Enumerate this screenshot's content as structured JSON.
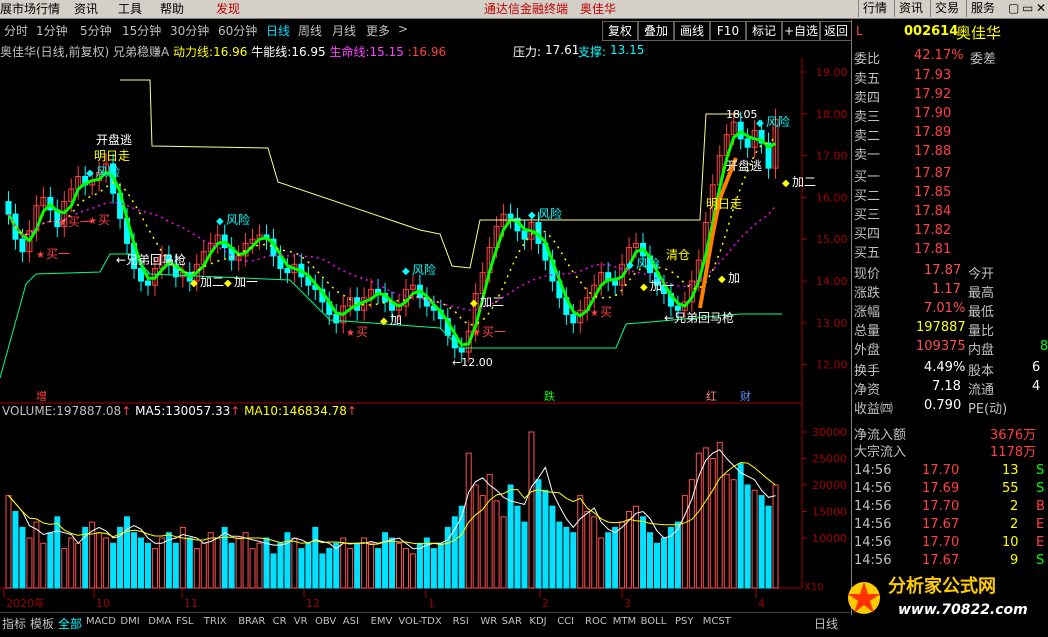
{
  "menu": {
    "items": [
      "展市场行情",
      "资讯",
      "工具",
      "帮助",
      "发现"
    ],
    "center": [
      "通达信金融终端",
      "奥佳华"
    ],
    "right": [
      "行情",
      "资讯",
      "交易",
      "服务"
    ],
    "win": [
      "▢",
      "▭",
      "✕"
    ]
  },
  "toolbar": {
    "periods": [
      "分时",
      "1分钟",
      "5分钟",
      "15分钟",
      "30分钟",
      "60分钟",
      "日线",
      "周线",
      "月线",
      "更多"
    ],
    "more_arrow": ">",
    "buttons": [
      "复权",
      "叠加",
      "画线",
      "F10",
      "标记",
      "+自选",
      "返回"
    ]
  },
  "info": {
    "name": "奥佳华(日线,前复权) 兄弟稳赚A",
    "dongli_label": "动力线:",
    "dongli": "16.96",
    "niuneng_label": "牛能线:",
    "niuneng": "16.95",
    "shengming_label": "生命线:",
    "shengming": "15.15",
    "extra": ":16.96",
    "yali_label": "压力:",
    "yali": "17.61",
    "zhicheng_label": "支撑:",
    "zhicheng": "13.15"
  },
  "vol_info": {
    "volume_label": "VOLUME:",
    "volume": "197887.08",
    "ma5_label": "MA5:",
    "ma5": "130057.33",
    "ma10_label": "MA10:",
    "ma10": "146834.78"
  },
  "price_axis": [
    "19.00",
    "18.00",
    "17.00",
    "16.00",
    "15.00",
    "14.00",
    "13.00",
    "12.00"
  ],
  "vol_axis": [
    "30000",
    "25000",
    "20000",
    "15000",
    "10000"
  ],
  "vol_unit": "X10",
  "date_axis": [
    "2020年",
    "10",
    "11",
    "12",
    "1",
    "2",
    "3",
    "4"
  ],
  "annotations": {
    "kaipan1": "开盘逃",
    "mingrizou": "明日走",
    "kaipan2": "开盘逃",
    "mingrizou2": "明日走",
    "xiongdi1": "←兄弟回马枪",
    "xiongdi2": "←兄弟回马枪",
    "low": "←12.00",
    "high": "18.05",
    "qingcang": "清仓",
    "fengxian": "风险",
    "mai": "买",
    "maiyi": "买一",
    "jiayi": "加一",
    "jiaer": "加二",
    "jia": "加",
    "zeng": "增",
    "die": "跌",
    "hong": "红",
    "cai": "财"
  },
  "quote": {
    "code": "002614",
    "name": "奥佳华",
    "L": "L",
    "weibi_label": "委比",
    "weibi": "42.17%",
    "weicha_label": "委差",
    "asks": [
      {
        "label": "卖五",
        "price": "17.93"
      },
      {
        "label": "卖四",
        "price": "17.92"
      },
      {
        "label": "卖三",
        "price": "17.90"
      },
      {
        "label": "卖二",
        "price": "17.89"
      },
      {
        "label": "卖一",
        "price": "17.88"
      }
    ],
    "bids": [
      {
        "label": "买一",
        "price": "17.87"
      },
      {
        "label": "买二",
        "price": "17.85"
      },
      {
        "label": "买三",
        "price": "17.84"
      },
      {
        "label": "买四",
        "price": "17.82"
      },
      {
        "label": "买五",
        "price": "17.81"
      }
    ],
    "stats": [
      {
        "l": "现价",
        "v": "17.87",
        "r": "今开",
        "c": "#ff5050"
      },
      {
        "l": "涨跌",
        "v": "1.17",
        "r": "最高",
        "c": "#ff5050"
      },
      {
        "l": "涨幅",
        "v": "7.01%",
        "r": "最低",
        "c": "#ff5050"
      },
      {
        "l": "总量",
        "v": "197887",
        "r": "量比",
        "c": "#ffff00"
      },
      {
        "l": "外盘",
        "v": "109375",
        "r": "内盘",
        "c": "#ff5050"
      }
    ],
    "stats2": [
      {
        "l": "换手",
        "v": "4.49%",
        "r": "股本",
        "rv": "6"
      },
      {
        "l": "净资",
        "v": "7.18",
        "r": "流通",
        "rv": "4"
      },
      {
        "l": "收益㈣",
        "v": "0.790",
        "r": "PE(动)",
        "rv": ""
      }
    ],
    "jinliu_label": "净流入额",
    "jinliu": "3676万",
    "dazong_label": "大宗流入",
    "dazong": "1178万",
    "ticks": [
      {
        "t": "14:56",
        "p": "17.70",
        "v": "13",
        "s": "S"
      },
      {
        "t": "14:56",
        "p": "17.69",
        "v": "55",
        "s": "S"
      },
      {
        "t": "14:56",
        "p": "17.70",
        "v": "2",
        "s": "B"
      },
      {
        "t": "14:56",
        "p": "17.67",
        "v": "2",
        "s": "E"
      },
      {
        "t": "14:56",
        "p": "17.70",
        "v": "10",
        "s": "E"
      },
      {
        "t": "14:56",
        "p": "17.67",
        "v": "9",
        "s": "S"
      }
    ],
    "neipan_v": "8"
  },
  "bottom": {
    "tabs": [
      "指标",
      "模板",
      "全部",
      "MACD",
      "DMI",
      "DMA",
      "FSL",
      "TRIX",
      "BRAR",
      "CR",
      "VR",
      "OBV",
      "ASI",
      "EMV",
      "VOL-TDX",
      "RSI",
      "WR",
      "SAR",
      "KDJ",
      "CCI",
      "ROC",
      "MTM",
      "BOLL",
      "PSY",
      "MCST"
    ],
    "right": "日线"
  },
  "logo": {
    "name": "分析家公式网",
    "url": "www.70822.com"
  },
  "colors": {
    "up": "#ff4040",
    "down": "#00ffff",
    "yellow": "#ffff00",
    "magenta": "#ff00ff"
  }
}
